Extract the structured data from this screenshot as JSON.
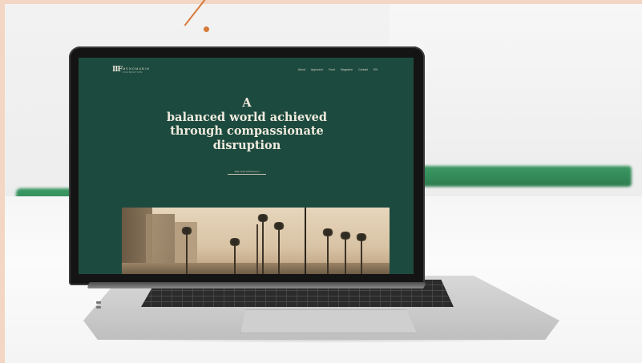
{
  "site": {
    "logo_mark": "IIF",
    "logo_name": "MENOMABIN",
    "logo_sub": "FOUNDATION",
    "nav": [
      "About",
      "Approach",
      "Fund",
      "Magazine",
      "Contact",
      "EN"
    ]
  },
  "hero": {
    "line1": "A",
    "line2": "balanced world achieved",
    "line3": "through compassionate",
    "line4": "disruption",
    "cta": "SEE OUR APPROACH"
  },
  "colors": {
    "screen_bg": "#1d4a3e",
    "headline": "#f0ebdf",
    "accent_pointer": "#d77a3a"
  }
}
